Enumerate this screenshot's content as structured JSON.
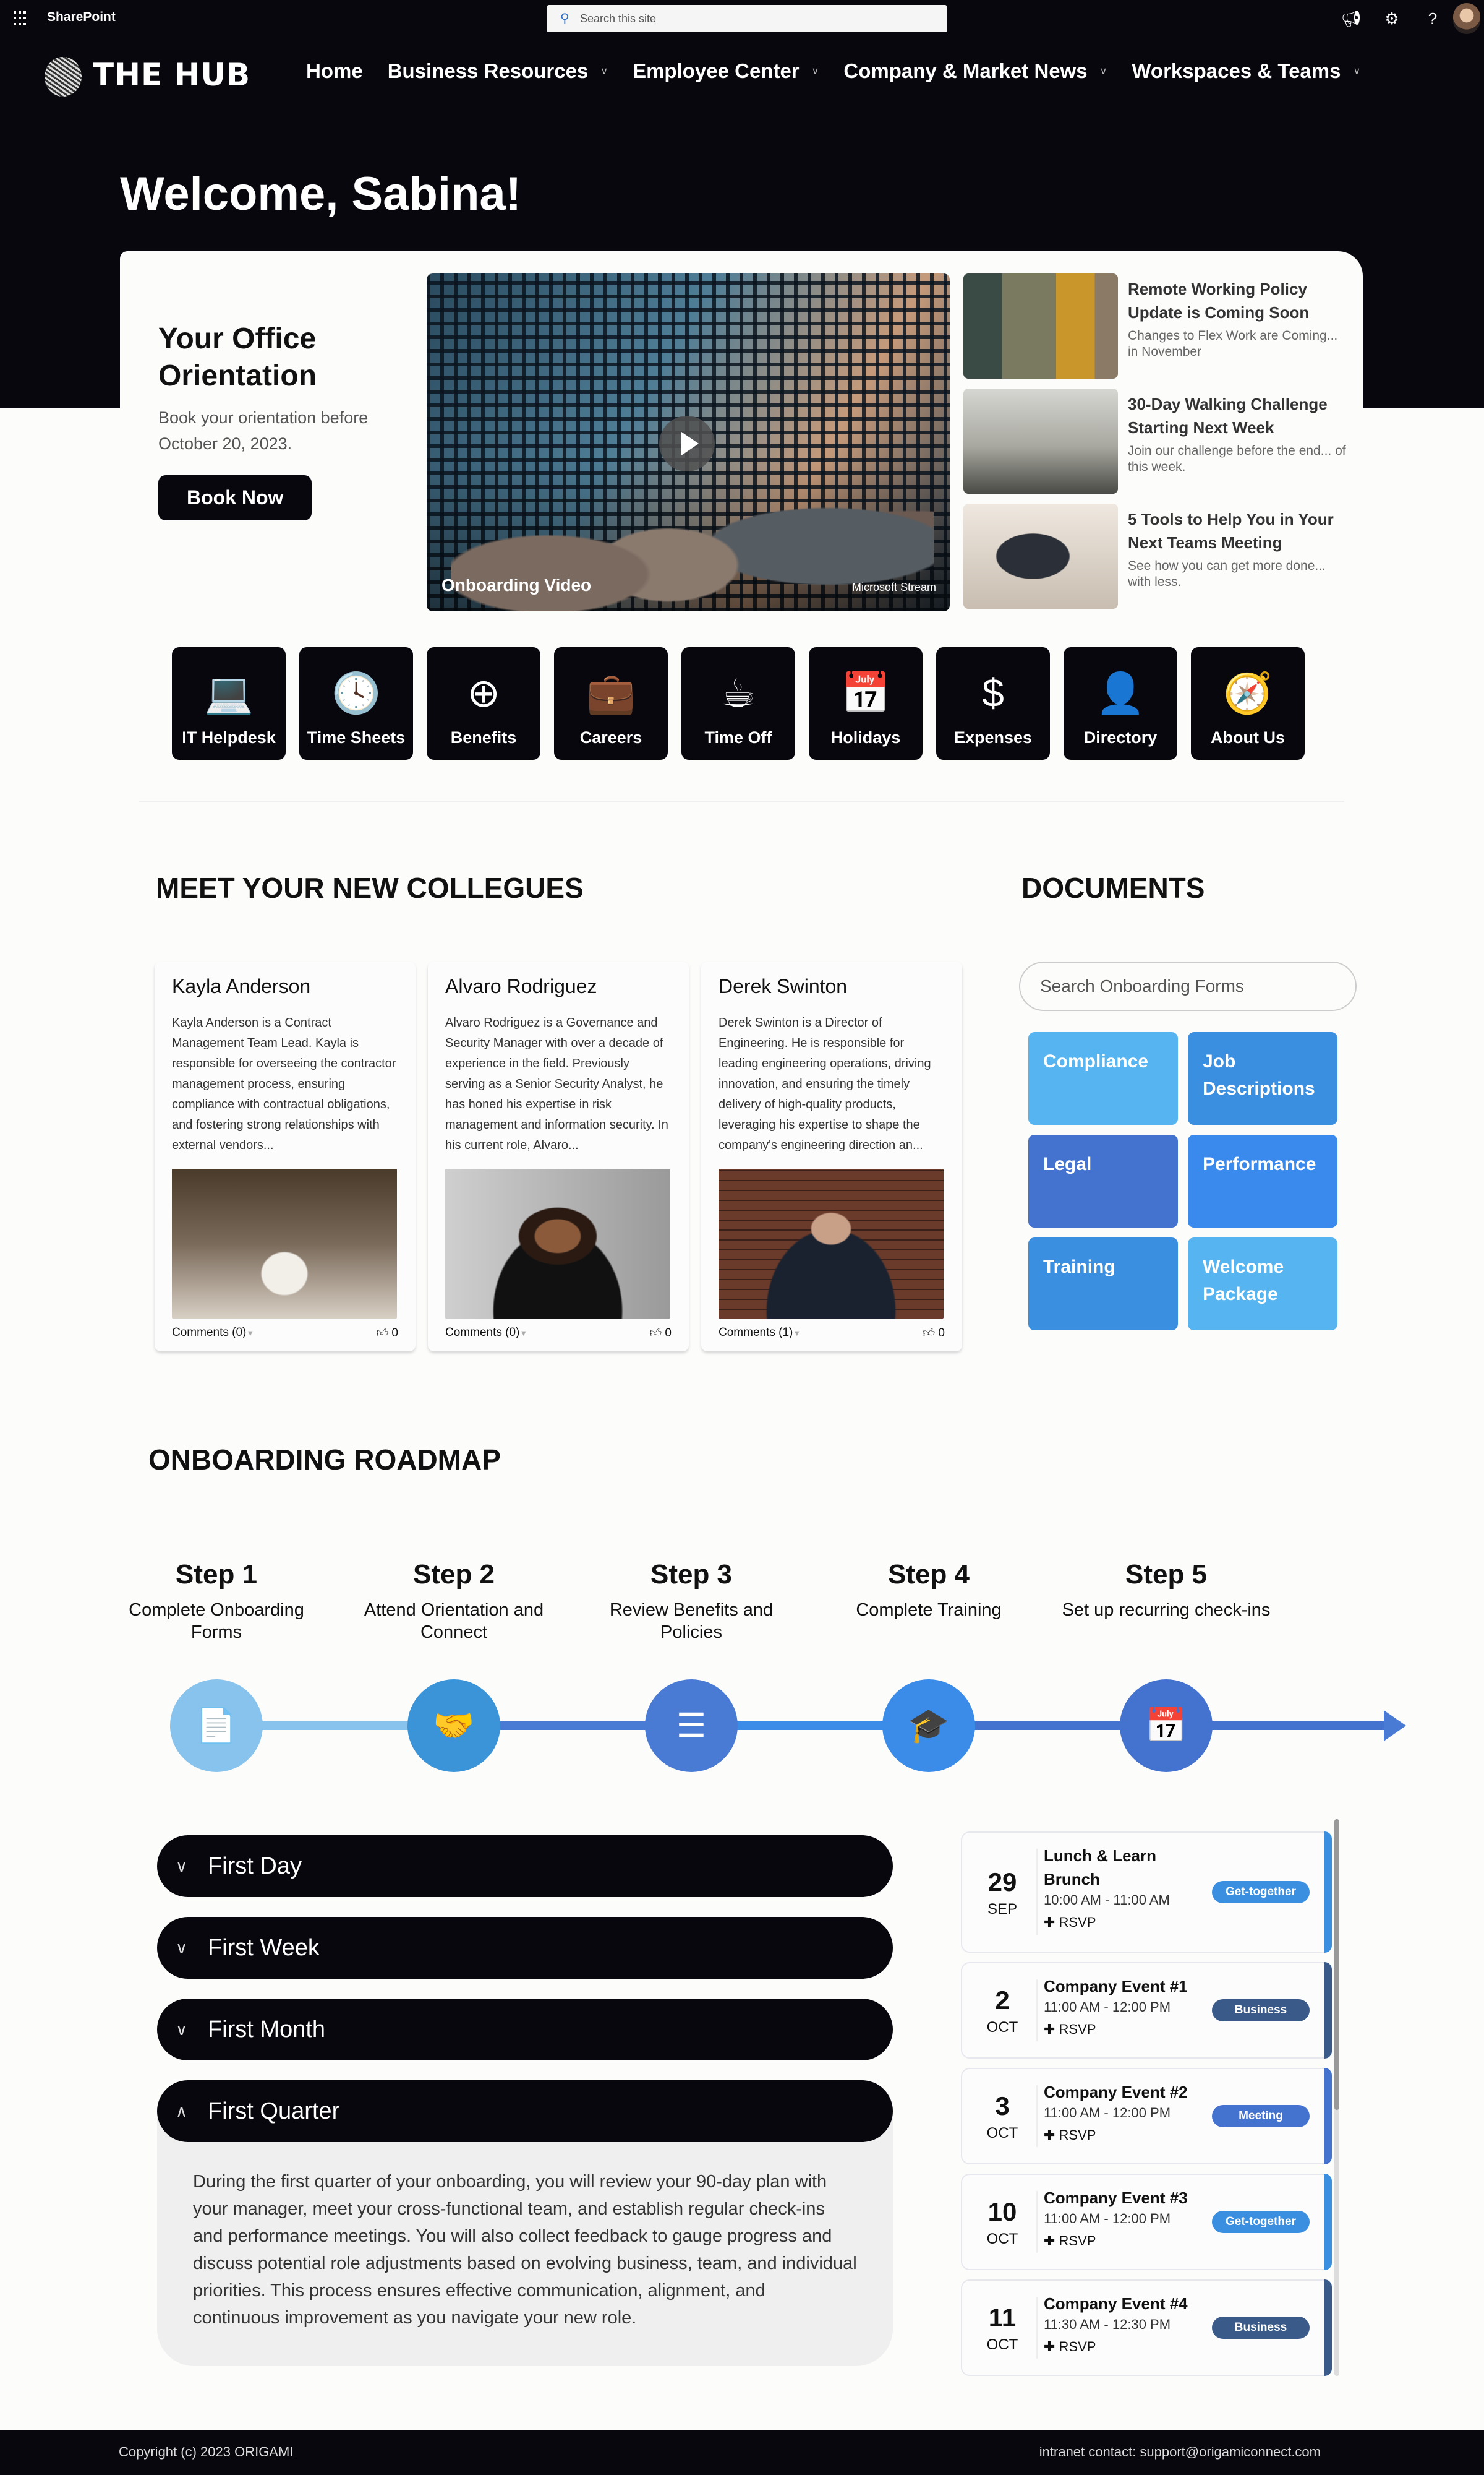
{
  "suite": {
    "app_name": "SharePoint",
    "search_placeholder": "Search this site",
    "icons": [
      "megaphone-icon",
      "gear-icon",
      "help-icon"
    ]
  },
  "hub": {
    "logo_text": "THE HUB",
    "nav": [
      {
        "label": "Home",
        "has_menu": false
      },
      {
        "label": "Business Resources",
        "has_menu": true
      },
      {
        "label": "Employee Center",
        "has_menu": true
      },
      {
        "label": "Company & Market News",
        "has_menu": true
      },
      {
        "label": "Workspaces & Teams",
        "has_menu": true
      }
    ],
    "welcome": "Welcome, Sabina!"
  },
  "hero": {
    "title": "Your Office Orientation",
    "subtitle": "Book your orientation before October 20, 2023.",
    "button": "Book Now",
    "video": {
      "title": "Onboarding Video",
      "source": "Microsoft Stream"
    },
    "news": [
      {
        "title": "Remote Working Policy Update is Coming Soon",
        "desc": "Changes to Flex Work are Coming... in November"
      },
      {
        "title": "30-Day Walking Challenge Starting Next Week",
        "desc": "Join our challenge before the end... of this week."
      },
      {
        "title": "5 Tools to Help You in Your Next Teams Meeting",
        "desc": "See how you can get more done... with less."
      }
    ]
  },
  "quick_links": [
    {
      "label": "IT Helpdesk",
      "icon": "laptop-icon",
      "glyph": "💻"
    },
    {
      "label": "Time Sheets",
      "icon": "clock-icon",
      "glyph": "🕓"
    },
    {
      "label": "Benefits",
      "icon": "plus-circle-icon",
      "glyph": "⊕"
    },
    {
      "label": "Careers",
      "icon": "briefcase-icon",
      "glyph": "💼"
    },
    {
      "label": "Time Off",
      "icon": "coffee-icon",
      "glyph": "☕"
    },
    {
      "label": "Holidays",
      "icon": "calendar-icon",
      "glyph": "📅"
    },
    {
      "label": "Expenses",
      "icon": "dollar-coin-icon",
      "glyph": "$"
    },
    {
      "label": "Directory",
      "icon": "person-circle-icon",
      "glyph": "👤"
    },
    {
      "label": "About Us",
      "icon": "compass-icon",
      "glyph": "🧭"
    }
  ],
  "colleagues": {
    "heading": "MEET YOUR NEW COLLEGUES",
    "people": [
      {
        "name": "Kayla Anderson",
        "bio": "Kayla Anderson is a Contract Management Team Lead. Kayla is responsible for overseeing the contractor management process, ensuring compliance with contractual obligations, and fostering strong relationships with external vendors...",
        "comments": "Comments (0)",
        "likes": "0"
      },
      {
        "name": "Alvaro Rodriguez",
        "bio": "Alvaro Rodriguez is a Governance and Security Manager with over a decade of experience in the field. Previously serving as a Senior Security Analyst, he has honed his expertise in risk management and information security. In his current role, Alvaro...",
        "comments": "Comments (0)",
        "likes": "0"
      },
      {
        "name": "Derek Swinton",
        "bio": "Derek Swinton is a Director of Engineering. He is responsible for leading engineering operations, driving innovation, and ensuring the timely delivery of high-quality products, leveraging his expertise to shape the company's engineering direction an...",
        "comments": "Comments (1)",
        "likes": "0"
      }
    ]
  },
  "documents": {
    "heading": "DOCUMENTS",
    "search_placeholder": "Search Onboarding Forms",
    "tiles": [
      {
        "label": "Compliance",
        "color": "#56b4f0"
      },
      {
        "label": "Job Descriptions",
        "color": "#3b8fe0"
      },
      {
        "label": "Legal",
        "color": "#4472cf"
      },
      {
        "label": "Performance",
        "color": "#398aec"
      },
      {
        "label": "Training",
        "color": "#3b8fe0"
      },
      {
        "label": "Welcome Package",
        "color": "#56b4f0"
      }
    ]
  },
  "roadmap": {
    "heading": "ONBOARDING ROADMAP",
    "steps": [
      {
        "title": "Step 1",
        "desc": "Complete Onboarding Forms",
        "icon": "document-icon",
        "glyph": "📄",
        "color": "#87c3ec"
      },
      {
        "title": "Step 2",
        "desc": "Attend Orientation and Connect",
        "icon": "handshake-icon",
        "glyph": "🤝",
        "color": "#3b94d8"
      },
      {
        "title": "Step 3",
        "desc": "Review Benefits and Policies",
        "icon": "list-icon",
        "glyph": "☰",
        "color": "#4a7bd4"
      },
      {
        "title": "Step 4",
        "desc": "Complete Training",
        "icon": "graduation-cap-icon",
        "glyph": "🎓",
        "color": "#3a8ce8"
      },
      {
        "title": "Step 5",
        "desc": "Set up recurring check-ins",
        "icon": "calendar-check-icon",
        "glyph": "📅",
        "color": "#4472cf"
      }
    ],
    "accordion": [
      {
        "label": "First Day",
        "expanded": false
      },
      {
        "label": "First Week",
        "expanded": false
      },
      {
        "label": "First Month",
        "expanded": false
      },
      {
        "label": "First Quarter",
        "expanded": true,
        "body": "During the first quarter of your onboarding, you will review your 90-day plan with your manager, meet your cross-functional team, and establish regular check-ins and performance meetings. You will also collect feedback to gauge progress and discuss potential role adjustments based on evolving business, team, and individual priorities. This process ensures effective communication, alignment, and continuous improvement as you navigate your new role."
      }
    ]
  },
  "events": [
    {
      "day": "29",
      "month": "SEP",
      "title": "Lunch & Learn Brunch",
      "time": "10:00 AM - 11:00 AM",
      "rsvp": "RSVP",
      "tag": "Get-together",
      "color": "#3b8fe0"
    },
    {
      "day": "2",
      "month": "OCT",
      "title": "Company Event #1",
      "time": "11:00 AM - 12:00 PM",
      "rsvp": "RSVP",
      "tag": "Business",
      "color": "#3a5b8a"
    },
    {
      "day": "3",
      "month": "OCT",
      "title": "Company Event #2",
      "time": "11:00 AM - 12:00 PM",
      "rsvp": "RSVP",
      "tag": "Meeting",
      "color": "#4472cf"
    },
    {
      "day": "10",
      "month": "OCT",
      "title": "Company Event #3",
      "time": "11:00 AM - 12:00 PM",
      "rsvp": "RSVP",
      "tag": "Get-together",
      "color": "#3b8fe0"
    },
    {
      "day": "11",
      "month": "OCT",
      "title": "Company Event #4",
      "time": "11:30 AM - 12:30 PM",
      "rsvp": "RSVP",
      "tag": "Business",
      "color": "#3a5b8a"
    }
  ],
  "footer": {
    "copyright": "Copyright (c) 2023 ORIGAMI",
    "contact": "intranet contact: support@origamiconnect.com"
  }
}
